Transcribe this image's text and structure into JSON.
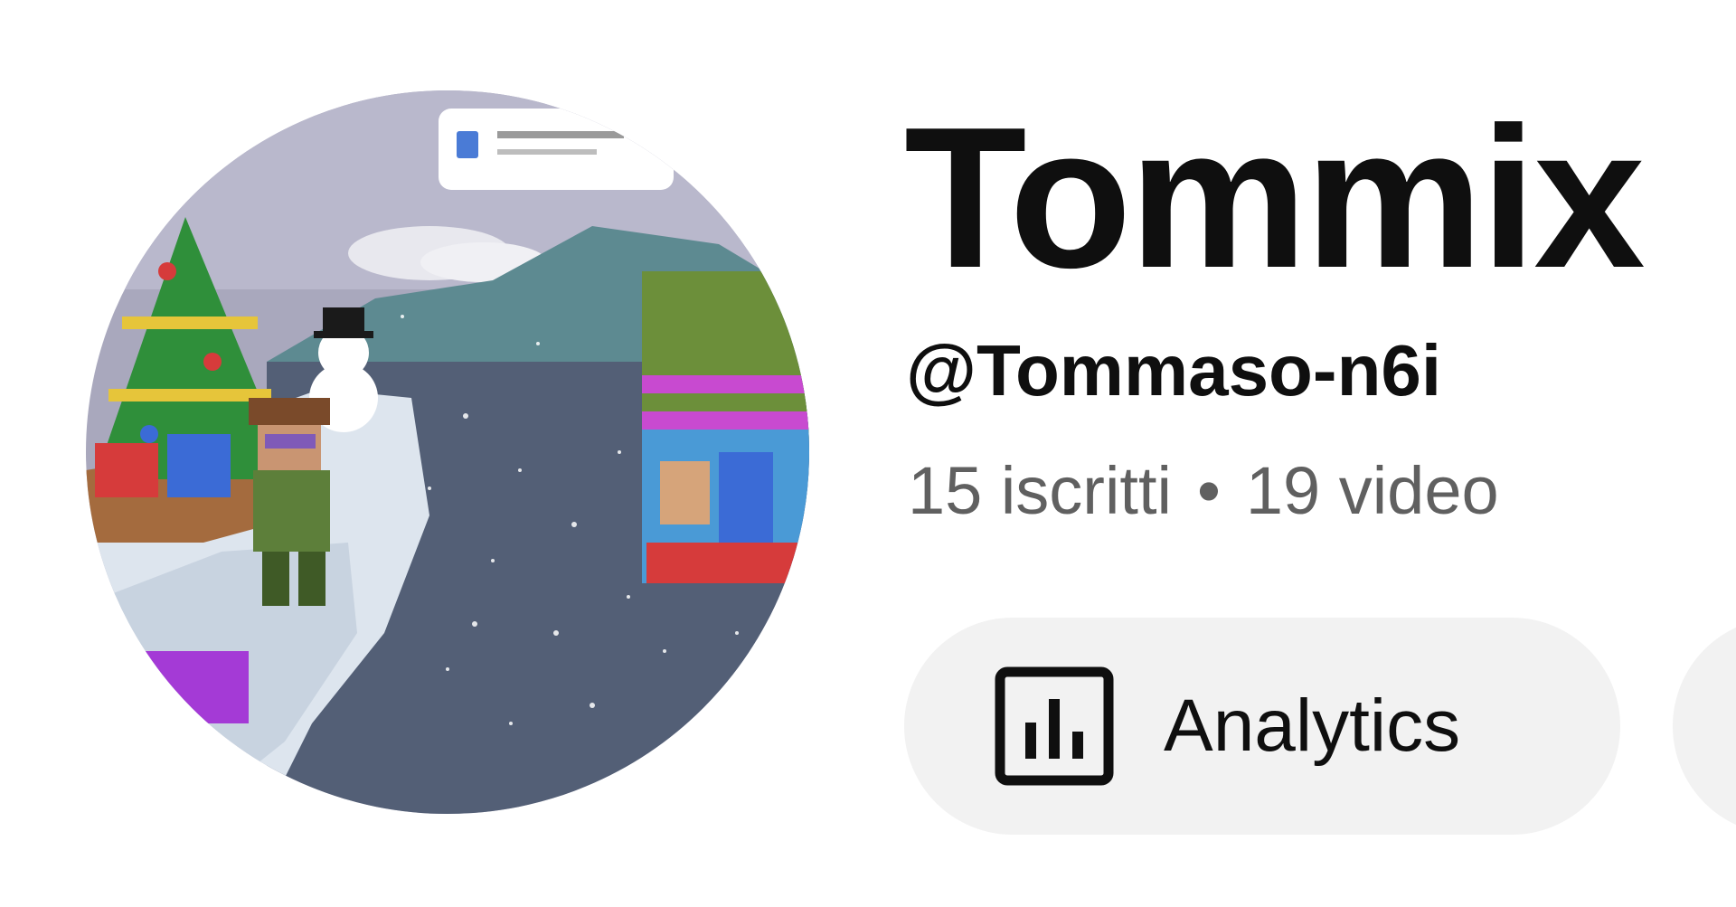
{
  "channel": {
    "name": "Tommix",
    "handle": "@Tommaso-n6i",
    "subscribers": "15 iscritti",
    "separator": "•",
    "videos": "19 video"
  },
  "actions": {
    "analytics_label": "Analytics"
  },
  "icons": {
    "analytics": "analytics-icon"
  },
  "colors": {
    "text_primary": "#0f0f0f",
    "text_secondary": "#606060",
    "button_bg": "#f2f2f2"
  }
}
